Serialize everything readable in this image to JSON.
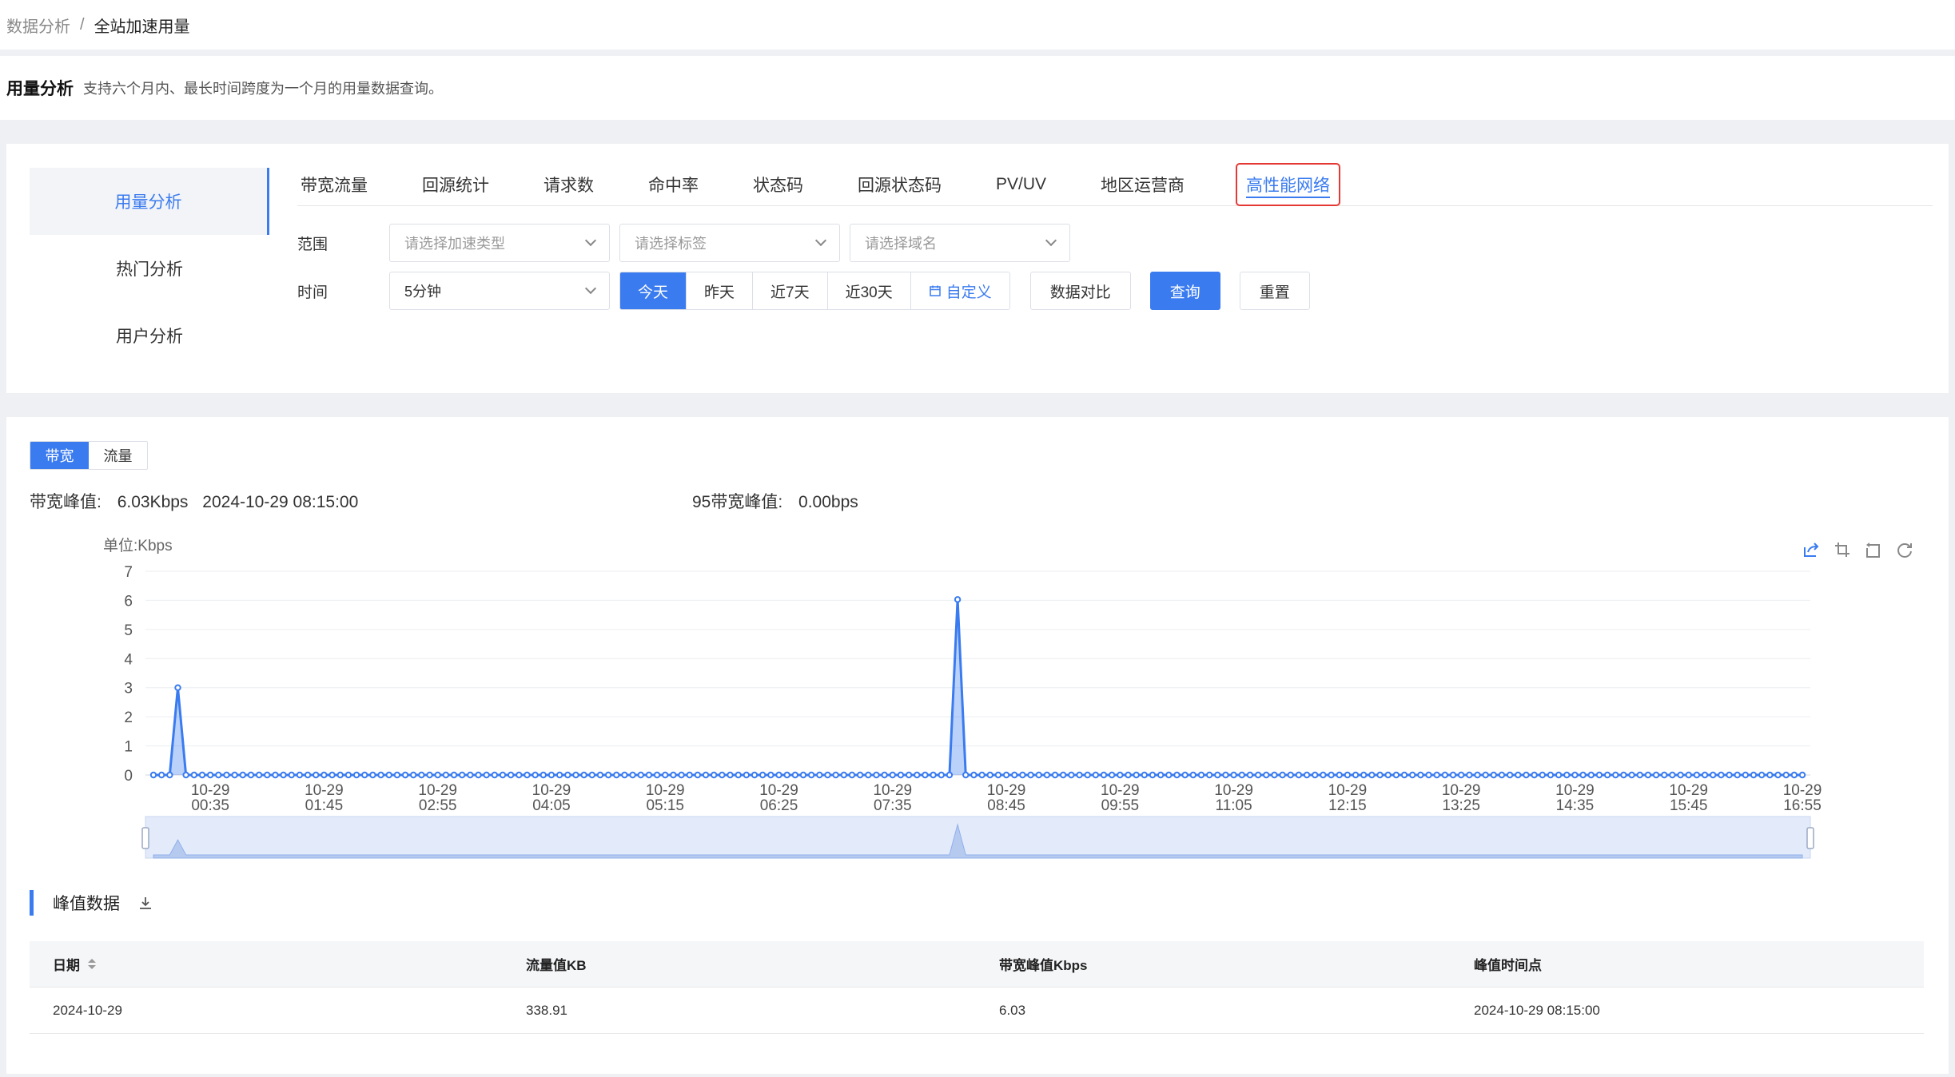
{
  "breadcrumb": {
    "parent": "数据分析",
    "separator": "/",
    "current": "全站加速用量"
  },
  "intro": {
    "title": "用量分析",
    "description": "支持六个月内、最长时间跨度为一个月的用量数据查询。"
  },
  "side_nav": {
    "items": [
      {
        "label": "用量分析",
        "active": true
      },
      {
        "label": "热门分析",
        "active": false
      },
      {
        "label": "用户分析",
        "active": false
      }
    ]
  },
  "tabs": [
    {
      "label": "带宽流量",
      "active": false
    },
    {
      "label": "回源统计",
      "active": false
    },
    {
      "label": "请求数",
      "active": false
    },
    {
      "label": "命中率",
      "active": false
    },
    {
      "label": "状态码",
      "active": false
    },
    {
      "label": "回源状态码",
      "active": false
    },
    {
      "label": "PV/UV",
      "active": false
    },
    {
      "label": "地区运营商",
      "active": false
    },
    {
      "label": "高性能网络",
      "active": true
    }
  ],
  "filters": {
    "range_label": "范围",
    "accel_type_placeholder": "请选择加速类型",
    "tag_placeholder": "请选择标签",
    "domain_placeholder": "请选择域名",
    "time_label": "时间",
    "granularity_value": "5分钟",
    "quick_ranges": [
      "今天",
      "昨天",
      "近7天",
      "近30天"
    ],
    "active_range": "今天",
    "custom_label": "自定义",
    "compare_label": "数据对比",
    "query_label": "查询",
    "reset_label": "重置"
  },
  "mode_toggle": {
    "bandwidth": "带宽",
    "traffic": "流量",
    "active": "带宽"
  },
  "peak": {
    "bandwidth_label": "带宽峰值:",
    "bandwidth_value": "6.03Kbps",
    "bandwidth_time": "2024-10-29 08:15:00",
    "p95_label": "95带宽峰值:",
    "p95_value": "0.00bps"
  },
  "colors": {
    "accent": "#3a7bf0",
    "highlight_border": "#e53935"
  },
  "chart_data": {
    "type": "area",
    "ylabel": "单位:Kbps",
    "ylim": [
      0,
      7
    ],
    "yticks": [
      0,
      1,
      2,
      3,
      4,
      5,
      6,
      7
    ],
    "grid": true,
    "x_ticks": [
      [
        "10-29",
        "00:35"
      ],
      [
        "10-29",
        "01:45"
      ],
      [
        "10-29",
        "02:55"
      ],
      [
        "10-29",
        "04:05"
      ],
      [
        "10-29",
        "05:15"
      ],
      [
        "10-29",
        "06:25"
      ],
      [
        "10-29",
        "07:35"
      ],
      [
        "10-29",
        "08:45"
      ],
      [
        "10-29",
        "09:55"
      ],
      [
        "10-29",
        "11:05"
      ],
      [
        "10-29",
        "12:15"
      ],
      [
        "10-29",
        "13:25"
      ],
      [
        "10-29",
        "14:35"
      ],
      [
        "10-29",
        "15:45"
      ],
      [
        "10-29",
        "16:55"
      ]
    ],
    "x_start": "10-29 00:00",
    "interval_minutes": 5,
    "count": 204,
    "default_value": 0,
    "nonzero_points": [
      {
        "x": "10-29 00:15",
        "y": 3.0
      },
      {
        "x": "10-29 08:15",
        "y": 6.03
      }
    ],
    "series": [
      {
        "name": "带宽"
      }
    ]
  },
  "toolbox_icons": [
    "share-icon",
    "zoom-select-icon",
    "zoom-reset-icon",
    "refresh-icon"
  ],
  "peak_section": {
    "title": "峰值数据"
  },
  "table": {
    "headers": [
      "日期",
      "流量值KB",
      "带宽峰值Kbps",
      "峰值时间点"
    ],
    "rows": [
      [
        "2024-10-29",
        "338.91",
        "6.03",
        "2024-10-29 08:15:00"
      ]
    ]
  }
}
